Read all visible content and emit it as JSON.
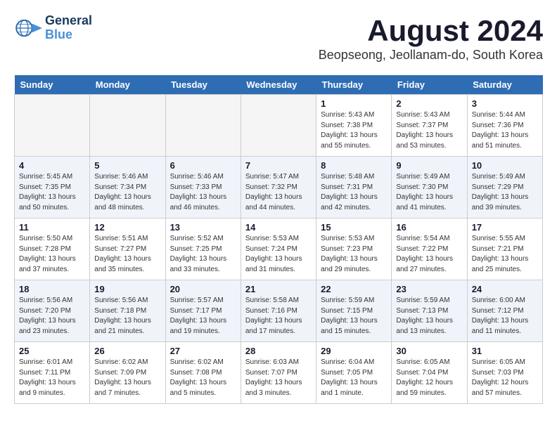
{
  "header": {
    "logo_line1": "General",
    "logo_line2": "Blue",
    "month": "August 2024",
    "location": "Beopseong, Jeollanam-do, South Korea"
  },
  "weekdays": [
    "Sunday",
    "Monday",
    "Tuesday",
    "Wednesday",
    "Thursday",
    "Friday",
    "Saturday"
  ],
  "weeks": [
    [
      {
        "day": "",
        "info": ""
      },
      {
        "day": "",
        "info": ""
      },
      {
        "day": "",
        "info": ""
      },
      {
        "day": "",
        "info": ""
      },
      {
        "day": "1",
        "info": "Sunrise: 5:43 AM\nSunset: 7:38 PM\nDaylight: 13 hours\nand 55 minutes."
      },
      {
        "day": "2",
        "info": "Sunrise: 5:43 AM\nSunset: 7:37 PM\nDaylight: 13 hours\nand 53 minutes."
      },
      {
        "day": "3",
        "info": "Sunrise: 5:44 AM\nSunset: 7:36 PM\nDaylight: 13 hours\nand 51 minutes."
      }
    ],
    [
      {
        "day": "4",
        "info": "Sunrise: 5:45 AM\nSunset: 7:35 PM\nDaylight: 13 hours\nand 50 minutes."
      },
      {
        "day": "5",
        "info": "Sunrise: 5:46 AM\nSunset: 7:34 PM\nDaylight: 13 hours\nand 48 minutes."
      },
      {
        "day": "6",
        "info": "Sunrise: 5:46 AM\nSunset: 7:33 PM\nDaylight: 13 hours\nand 46 minutes."
      },
      {
        "day": "7",
        "info": "Sunrise: 5:47 AM\nSunset: 7:32 PM\nDaylight: 13 hours\nand 44 minutes."
      },
      {
        "day": "8",
        "info": "Sunrise: 5:48 AM\nSunset: 7:31 PM\nDaylight: 13 hours\nand 42 minutes."
      },
      {
        "day": "9",
        "info": "Sunrise: 5:49 AM\nSunset: 7:30 PM\nDaylight: 13 hours\nand 41 minutes."
      },
      {
        "day": "10",
        "info": "Sunrise: 5:49 AM\nSunset: 7:29 PM\nDaylight: 13 hours\nand 39 minutes."
      }
    ],
    [
      {
        "day": "11",
        "info": "Sunrise: 5:50 AM\nSunset: 7:28 PM\nDaylight: 13 hours\nand 37 minutes."
      },
      {
        "day": "12",
        "info": "Sunrise: 5:51 AM\nSunset: 7:27 PM\nDaylight: 13 hours\nand 35 minutes."
      },
      {
        "day": "13",
        "info": "Sunrise: 5:52 AM\nSunset: 7:25 PM\nDaylight: 13 hours\nand 33 minutes."
      },
      {
        "day": "14",
        "info": "Sunrise: 5:53 AM\nSunset: 7:24 PM\nDaylight: 13 hours\nand 31 minutes."
      },
      {
        "day": "15",
        "info": "Sunrise: 5:53 AM\nSunset: 7:23 PM\nDaylight: 13 hours\nand 29 minutes."
      },
      {
        "day": "16",
        "info": "Sunrise: 5:54 AM\nSunset: 7:22 PM\nDaylight: 13 hours\nand 27 minutes."
      },
      {
        "day": "17",
        "info": "Sunrise: 5:55 AM\nSunset: 7:21 PM\nDaylight: 13 hours\nand 25 minutes."
      }
    ],
    [
      {
        "day": "18",
        "info": "Sunrise: 5:56 AM\nSunset: 7:20 PM\nDaylight: 13 hours\nand 23 minutes."
      },
      {
        "day": "19",
        "info": "Sunrise: 5:56 AM\nSunset: 7:18 PM\nDaylight: 13 hours\nand 21 minutes."
      },
      {
        "day": "20",
        "info": "Sunrise: 5:57 AM\nSunset: 7:17 PM\nDaylight: 13 hours\nand 19 minutes."
      },
      {
        "day": "21",
        "info": "Sunrise: 5:58 AM\nSunset: 7:16 PM\nDaylight: 13 hours\nand 17 minutes."
      },
      {
        "day": "22",
        "info": "Sunrise: 5:59 AM\nSunset: 7:15 PM\nDaylight: 13 hours\nand 15 minutes."
      },
      {
        "day": "23",
        "info": "Sunrise: 5:59 AM\nSunset: 7:13 PM\nDaylight: 13 hours\nand 13 minutes."
      },
      {
        "day": "24",
        "info": "Sunrise: 6:00 AM\nSunset: 7:12 PM\nDaylight: 13 hours\nand 11 minutes."
      }
    ],
    [
      {
        "day": "25",
        "info": "Sunrise: 6:01 AM\nSunset: 7:11 PM\nDaylight: 13 hours\nand 9 minutes."
      },
      {
        "day": "26",
        "info": "Sunrise: 6:02 AM\nSunset: 7:09 PM\nDaylight: 13 hours\nand 7 minutes."
      },
      {
        "day": "27",
        "info": "Sunrise: 6:02 AM\nSunset: 7:08 PM\nDaylight: 13 hours\nand 5 minutes."
      },
      {
        "day": "28",
        "info": "Sunrise: 6:03 AM\nSunset: 7:07 PM\nDaylight: 13 hours\nand 3 minutes."
      },
      {
        "day": "29",
        "info": "Sunrise: 6:04 AM\nSunset: 7:05 PM\nDaylight: 13 hours\nand 1 minute."
      },
      {
        "day": "30",
        "info": "Sunrise: 6:05 AM\nSunset: 7:04 PM\nDaylight: 12 hours\nand 59 minutes."
      },
      {
        "day": "31",
        "info": "Sunrise: 6:05 AM\nSunset: 7:03 PM\nDaylight: 12 hours\nand 57 minutes."
      }
    ]
  ]
}
